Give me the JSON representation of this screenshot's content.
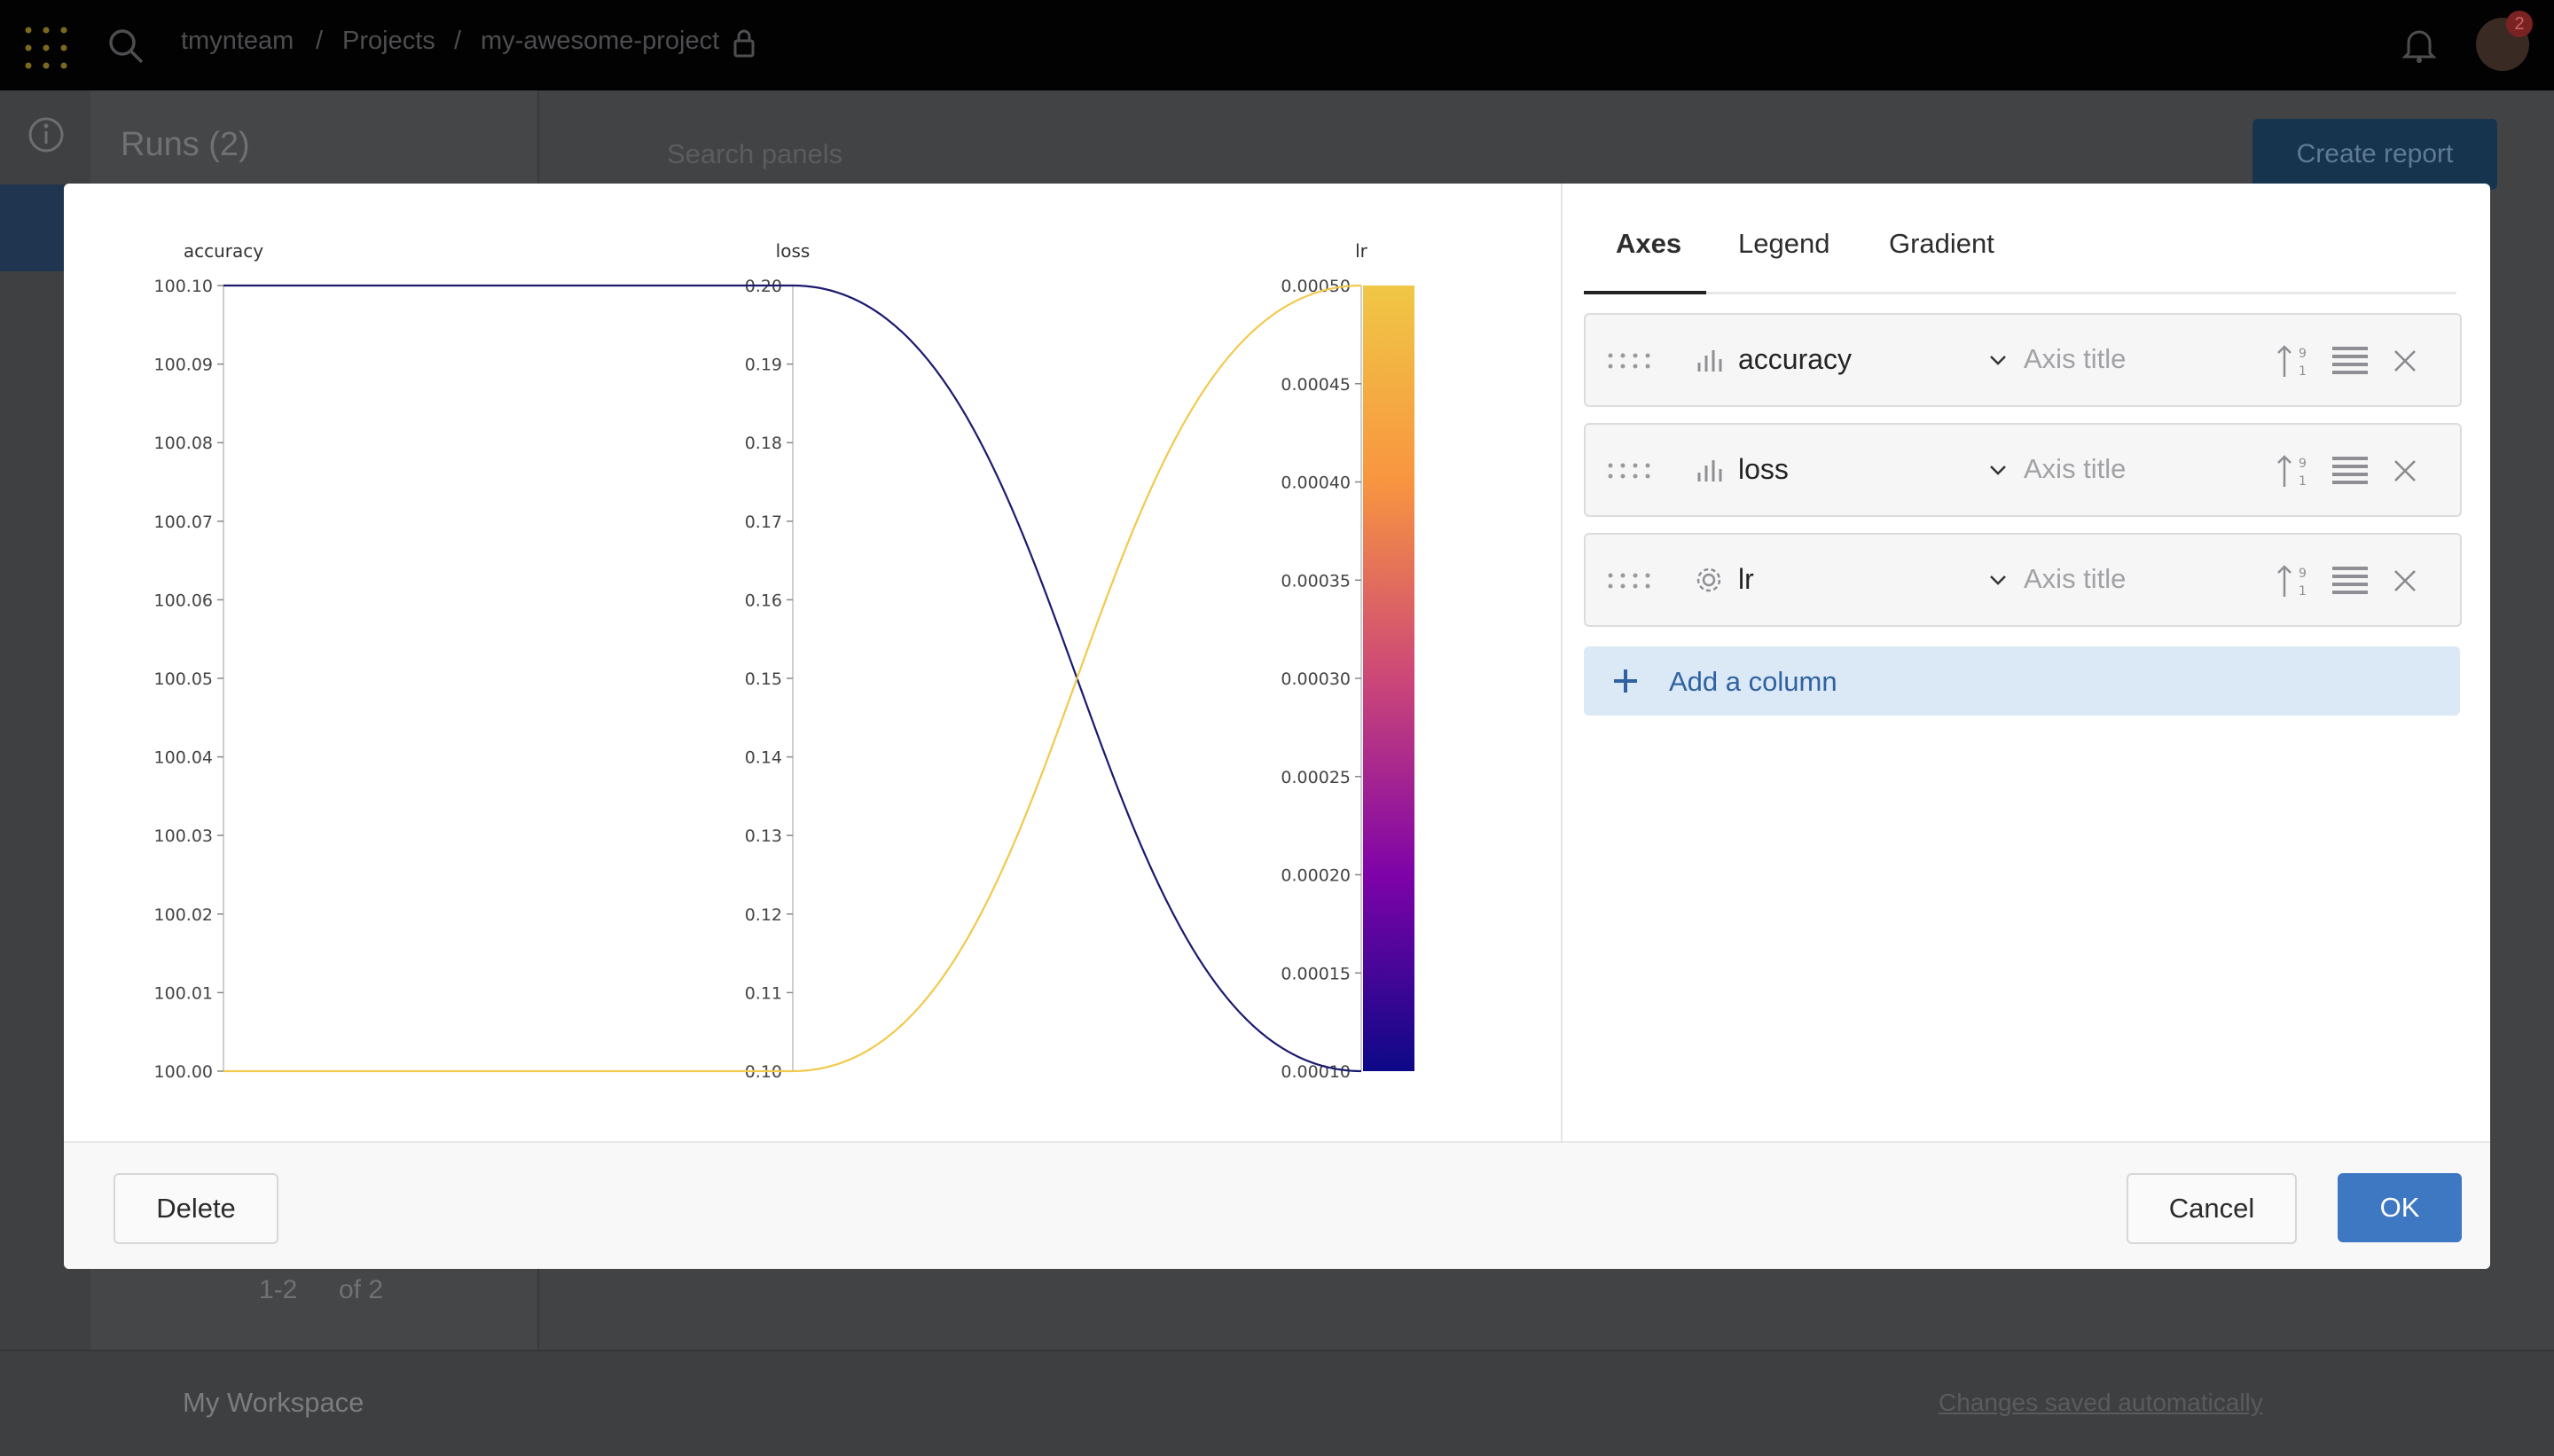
{
  "topbar": {
    "breadcrumb": [
      "tmynteam",
      "Projects",
      "my-awesome-project"
    ],
    "notification_count": "2"
  },
  "background": {
    "runs_title": "Runs (2)",
    "search_placeholder": "Search panels",
    "create_report": "Create report",
    "pagination": "1-2",
    "pagination_of": "of 2",
    "workspace": "My Workspace",
    "saved_status": "Changes saved automatically"
  },
  "tabs": [
    {
      "label": "Axes",
      "active": true
    },
    {
      "label": "Legend",
      "active": false
    },
    {
      "label": "Gradient",
      "active": false
    }
  ],
  "axes": [
    {
      "name": "accuracy",
      "icon": "bar-chart-icon",
      "placeholder": "Axis title"
    },
    {
      "name": "loss",
      "icon": "bar-chart-icon",
      "placeholder": "Axis title"
    },
    {
      "name": "lr",
      "icon": "gear-icon",
      "placeholder": "Axis title"
    }
  ],
  "add_column_label": "Add a column",
  "footer": {
    "delete": "Delete",
    "cancel": "Cancel",
    "ok": "OK"
  },
  "chart_data": {
    "type": "parallel-coordinates",
    "axes": [
      {
        "label": "accuracy",
        "range": [
          100.0,
          100.1
        ],
        "ticks": [
          "100.10",
          "100.09",
          "100.08",
          "100.07",
          "100.06",
          "100.05",
          "100.04",
          "100.03",
          "100.02",
          "100.01",
          "100.00"
        ]
      },
      {
        "label": "loss",
        "range": [
          0.1,
          0.2
        ],
        "ticks": [
          "0.20",
          "0.19",
          "0.18",
          "0.17",
          "0.16",
          "0.15",
          "0.14",
          "0.13",
          "0.12",
          "0.11",
          "0.10"
        ]
      },
      {
        "label": "lr",
        "range": [
          0.0001,
          0.0005
        ],
        "ticks": [
          "0.00050",
          "0.00045",
          "0.00040",
          "0.00035",
          "0.00030",
          "0.00025",
          "0.00020",
          "0.00015",
          "0.00010"
        ]
      }
    ],
    "lines": [
      {
        "values": [
          100.1,
          0.2,
          0.0001
        ],
        "color": "#1b1a6e"
      },
      {
        "values": [
          100.0,
          0.1,
          0.0005
        ],
        "color": "#f2c94c"
      }
    ],
    "gradient": [
      "#0d0887",
      "#7e03a8",
      "#cc4778",
      "#f89540",
      "#f0f921"
    ]
  }
}
